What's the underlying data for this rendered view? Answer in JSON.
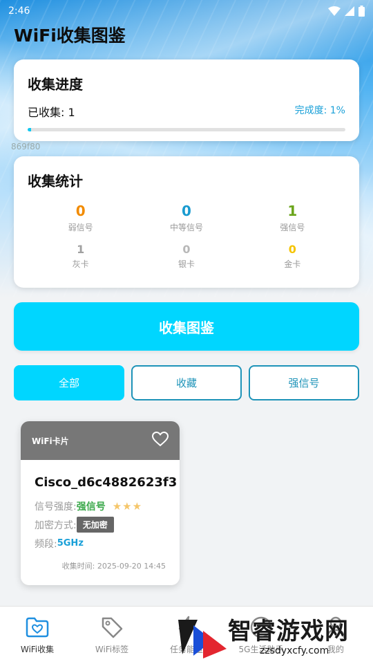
{
  "status_bar": {
    "time": "2:46"
  },
  "app": {
    "title": "WiFi收集图鉴"
  },
  "progress": {
    "title": "收集进度",
    "collected_label": "已收集: 1",
    "completion_label": "完成度: 1%",
    "completion_fraction": 0.01
  },
  "watermark_code": "869f80",
  "stats": {
    "title": "收集统计",
    "items": [
      {
        "value": "0",
        "label": "弱信号",
        "color": "#f28b00"
      },
      {
        "value": "0",
        "label": "中等信号",
        "color": "#1a9bd0"
      },
      {
        "value": "1",
        "label": "强信号",
        "color": "#6ba51c"
      },
      {
        "value": "1",
        "label": "灰卡",
        "color": "#a0a0a0"
      },
      {
        "value": "0",
        "label": "银卡",
        "color": "#b8b8b8"
      },
      {
        "value": "0",
        "label": "金卡",
        "color": "#f5c400"
      }
    ]
  },
  "collect_button": {
    "label": "收集图鉴"
  },
  "filters": {
    "all": "全部",
    "favorites": "收藏",
    "strong": "强信号"
  },
  "wifi_card": {
    "header_title": "WiFi卡片",
    "ssid": "Cisco_d6c4882623f3",
    "strength_label": "信号强度:",
    "strength_value": "强信号",
    "stars": "★★★",
    "encryption_label": "加密方式:",
    "encryption_value": "无加密",
    "band_label": "频段:",
    "band_value": "5GHz",
    "collect_time": "收集时间: 2025-09-20 14:45"
  },
  "bottom_nav": [
    {
      "label": "WiFi收集",
      "icon": "folder-heart-icon",
      "active": true
    },
    {
      "label": "WiFi标签",
      "icon": "tag-icon",
      "active": false
    },
    {
      "label": "任务能量",
      "icon": "lightning-icon",
      "active": false
    },
    {
      "label": "5G生活助手",
      "icon": "globe-icon",
      "active": false
    },
    {
      "label": "我的",
      "icon": "person-icon",
      "active": false
    }
  ],
  "logo": {
    "text": "智睿游戏网",
    "sub": "zzsdyxcfy.com"
  }
}
